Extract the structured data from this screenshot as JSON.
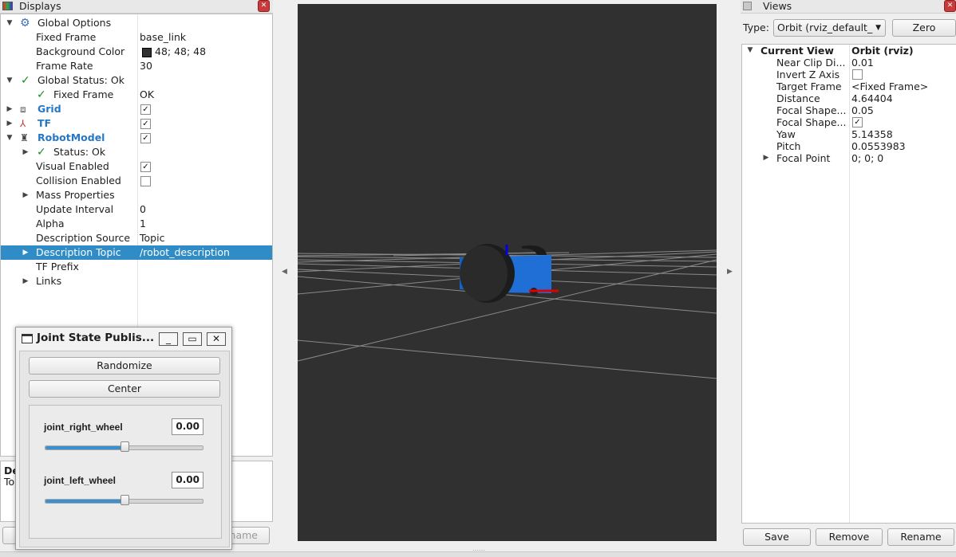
{
  "displays": {
    "title": "Displays",
    "rows": [
      {
        "label": "Global Options",
        "value": ""
      },
      {
        "label": "Fixed Frame",
        "value": "base_link"
      },
      {
        "label": "Background Color",
        "value": "48; 48; 48"
      },
      {
        "label": "Frame Rate",
        "value": "30"
      },
      {
        "label": "Global Status: Ok",
        "value": ""
      },
      {
        "label": "Fixed Frame",
        "value": "OK"
      },
      {
        "label": "Grid",
        "value": ""
      },
      {
        "label": "TF",
        "value": ""
      },
      {
        "label": "RobotModel",
        "value": ""
      },
      {
        "label": "Status: Ok",
        "value": ""
      },
      {
        "label": "Visual Enabled",
        "value": ""
      },
      {
        "label": "Collision Enabled",
        "value": ""
      },
      {
        "label": "Mass Properties",
        "value": ""
      },
      {
        "label": "Update Interval",
        "value": "0"
      },
      {
        "label": "Alpha",
        "value": "1"
      },
      {
        "label": "Description Source",
        "value": "Topic"
      },
      {
        "label": "Description Topic",
        "value": "/robot_description"
      },
      {
        "label": "TF Prefix",
        "value": ""
      },
      {
        "label": "Links",
        "value": ""
      }
    ],
    "description_title": "De",
    "description_text": "Top",
    "bottom_button_partial": "name"
  },
  "views": {
    "title": "Views",
    "type_label": "Type:",
    "type_value": "Orbit (rviz_default_",
    "zero_button": "Zero",
    "current_view_label": "Current View",
    "current_view_value": "Orbit (rviz)",
    "rows": [
      {
        "label": "Near Clip Di...",
        "value": "0.01"
      },
      {
        "label": "Invert Z Axis",
        "value": ""
      },
      {
        "label": "Target Frame",
        "value": "<Fixed Frame>"
      },
      {
        "label": "Distance",
        "value": "4.64404"
      },
      {
        "label": "Focal Shape...",
        "value": "0.05"
      },
      {
        "label": "Focal Shape...",
        "value": ""
      },
      {
        "label": "Yaw",
        "value": "5.14358"
      },
      {
        "label": "Pitch",
        "value": "0.0553983"
      },
      {
        "label": "Focal Point",
        "value": "0; 0; 0"
      }
    ],
    "save_button": "Save",
    "remove_button": "Remove",
    "rename_button": "Rename"
  },
  "joint_state_publisher": {
    "title": "Joint State Publis...",
    "randomize_button": "Randomize",
    "center_button": "Center",
    "joints": [
      {
        "name": "joint_right_wheel",
        "value": "0.00",
        "slider_fraction": 0.5
      },
      {
        "name": "joint_left_wheel",
        "value": "0.00",
        "slider_fraction": 0.5
      }
    ]
  },
  "colors": {
    "background": "#303030",
    "selection": "#308cc6",
    "display_name": "#2777c7",
    "robot_body": "#1f6fd6"
  },
  "icons": [
    "gear-icon",
    "check-icon",
    "grid-icon",
    "tf-icon",
    "robot-model-icon",
    "window-icon",
    "minimize-icon",
    "maximize-icon",
    "close-icon",
    "dropdown-arrow-icon"
  ]
}
